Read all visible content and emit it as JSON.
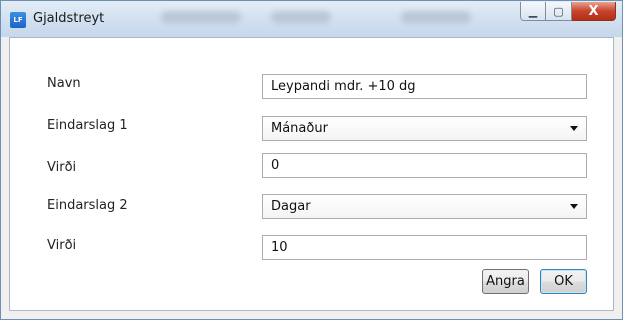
{
  "window": {
    "title": "Gjaldstreyt",
    "app_icon_text": "LF",
    "minimize_glyph": "▁",
    "maximize_glyph": "▢",
    "close_glyph": "X"
  },
  "form": {
    "name_label": "Navn",
    "name_value": "Leypandi mdr. +10 dg",
    "unit1_label": "Eindarslag 1",
    "unit1_value": "Mánaður",
    "value1_label": "Virði",
    "value1_value": "0",
    "unit2_label": "Eindarslag 2",
    "unit2_value": "Dagar",
    "value2_label": "Virði",
    "value2_value": "10"
  },
  "buttons": {
    "cancel_label": "Angra",
    "ok_label": "OK"
  },
  "colors": {
    "titlebar": "#d4e2f1",
    "close_button": "#c8432b",
    "ok_border": "#3c7fb1"
  }
}
